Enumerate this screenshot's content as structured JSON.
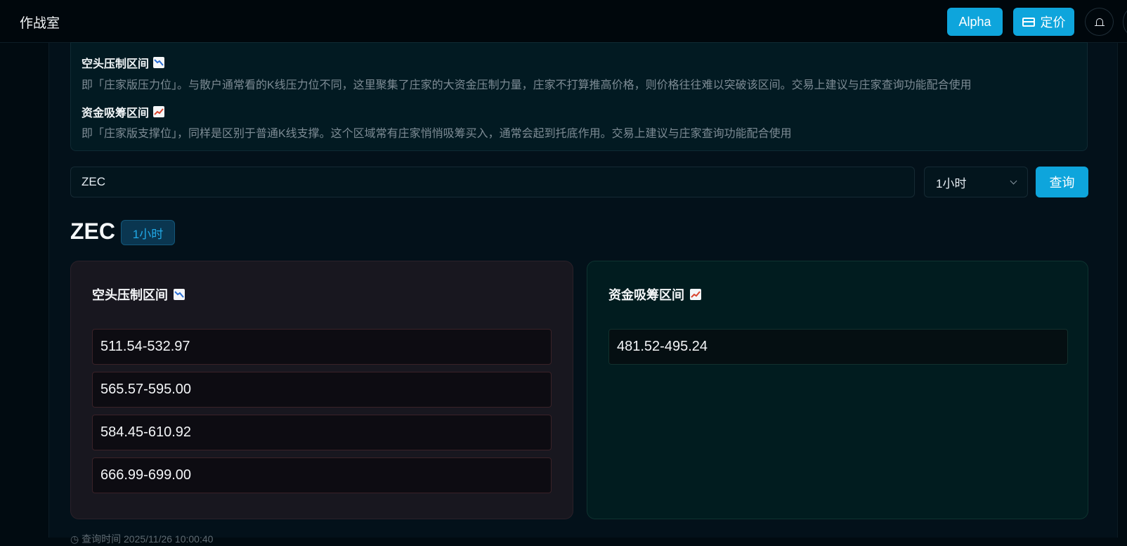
{
  "app": {
    "title": "作战室"
  },
  "header": {
    "alpha_label": "Alpha",
    "pricing_label": "定价"
  },
  "description": {
    "bear_title": "空头压制区间",
    "bear_text": "即「庄家版压力位」。与散户通常看的K线压力位不同，这里聚集了庄家的大资金压制力量，庄家不打算推高价格，则价格往往难以突破该区间。交易上建议与庄家查询功能配合使用",
    "fund_title": "资金吸筹区间",
    "fund_text": "即「庄家版支撑位」，同样是区别于普通K线支撑。这个区域常有庄家悄悄吸筹买入，通常会起到托底作用。交易上建议与庄家查询功能配合使用"
  },
  "search": {
    "value": "ZEC",
    "interval": "1小时",
    "query_label": "查询"
  },
  "result": {
    "symbol": "ZEC",
    "interval_badge": "1小时",
    "bear_panel": {
      "title": "空头压制区间",
      "ranges": [
        "511.54-532.97",
        "565.57-595.00",
        "584.45-610.92",
        "666.99-699.00"
      ]
    },
    "fund_panel": {
      "title": "资金吸筹区间",
      "ranges": [
        "481.52-495.24"
      ]
    },
    "footer_text": "查询时间 2025/11/26 10:00:40"
  },
  "colors": {
    "accent": "#0ea5dc",
    "bear_panel_bg": "#18171f",
    "fund_panel_bg": "#011c1f"
  }
}
